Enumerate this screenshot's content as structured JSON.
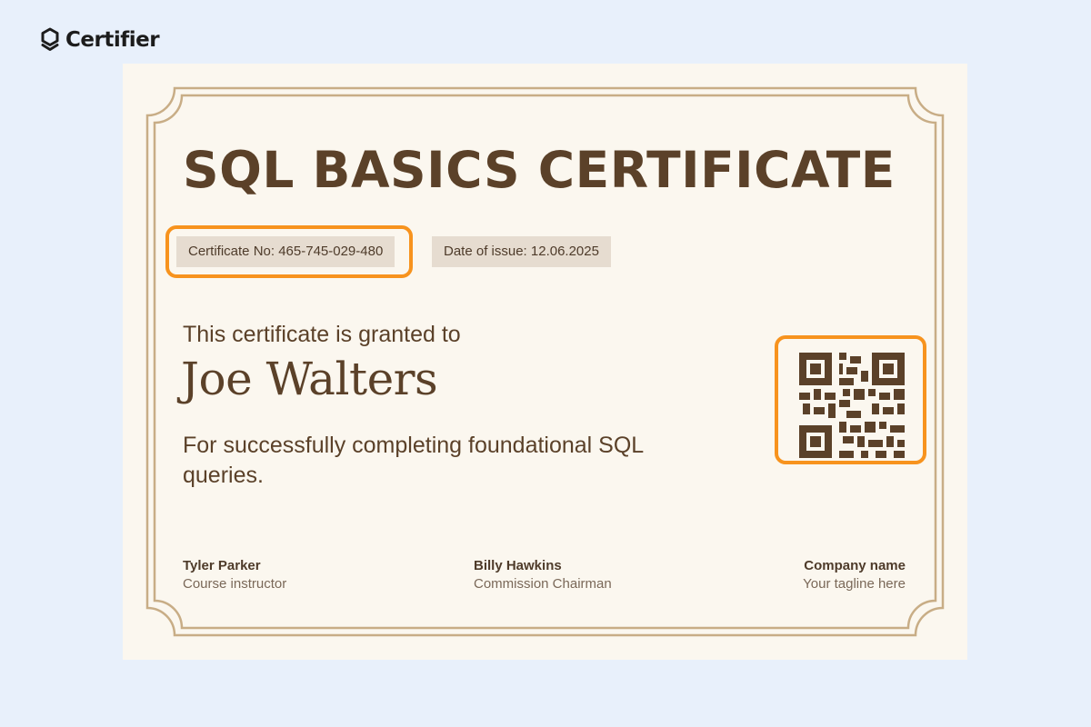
{
  "brand": {
    "name": "Certifier",
    "icon": "certifier-logo-icon"
  },
  "certificate": {
    "title": "SQL BASICS CERTIFICATE",
    "number_label": "Certificate No: 465-745-029-480",
    "date_label": "Date of issue: 12.06.2025",
    "granted_text": "This certificate is granted to",
    "recipient": "Joe Walters",
    "reason": "For successfully completing foundational SQL queries.",
    "qr_icon": "qr-code",
    "signatures": [
      {
        "name": "Tyler Parker",
        "role": "Course instructor"
      },
      {
        "name": "Billy Hawkins",
        "role": "Commission Chairman"
      },
      {
        "name": "Company name",
        "role": "Your tagline here"
      }
    ]
  },
  "colors": {
    "page_background": "#e8f0fb",
    "certificate_background": "#fbf7ef",
    "text_brown": "#5b4129",
    "frame_gold": "#c8ad86",
    "chip_background": "#e6dcd0",
    "highlight_orange": "#f7931e"
  }
}
